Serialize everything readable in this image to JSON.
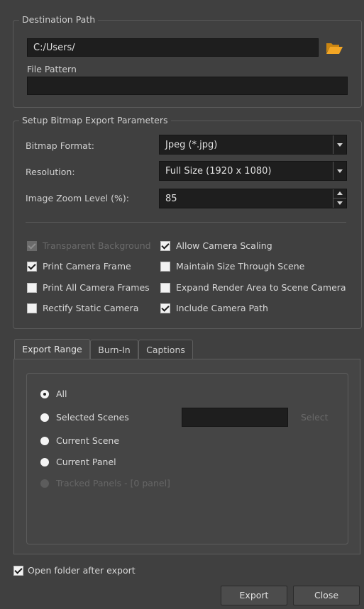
{
  "destination": {
    "title": "Destination Path",
    "path_value": "C:/Users/",
    "file_pattern_label": "File Pattern",
    "file_pattern_value": ""
  },
  "bitmap": {
    "title": "Setup Bitmap Export Parameters",
    "format_label": "Bitmap Format:",
    "format_value": "Jpeg (*.jpg)",
    "resolution_label": "Resolution:",
    "resolution_value": "Full Size (1920 x 1080)",
    "zoom_label": "Image Zoom Level (%):",
    "zoom_value": "85",
    "checkboxes": {
      "transparent_background": "Transparent Background",
      "allow_camera_scaling": "Allow Camera Scaling",
      "print_camera_frame": "Print Camera Frame",
      "maintain_size": "Maintain Size Through Scene",
      "print_all_camera_frames": "Print All Camera Frames",
      "expand_render_area": "Expand Render Area to Scene Camera",
      "rectify_static_camera": "Rectify Static Camera",
      "include_camera_path": "Include Camera Path"
    }
  },
  "tabs": {
    "export_range": "Export Range",
    "burn_in": "Burn-In",
    "captions": "Captions"
  },
  "range": {
    "all": "All",
    "selected_scenes": "Selected Scenes",
    "select_button": "Select",
    "current_scene": "Current Scene",
    "current_panel": "Current Panel",
    "tracked_panels": "Tracked Panels - [0 panel]"
  },
  "footer": {
    "open_folder": "Open folder after export",
    "export_button": "Export",
    "close_button": "Close"
  },
  "icons": {
    "folder": "folder-icon",
    "folder_color": "#f0a020"
  }
}
